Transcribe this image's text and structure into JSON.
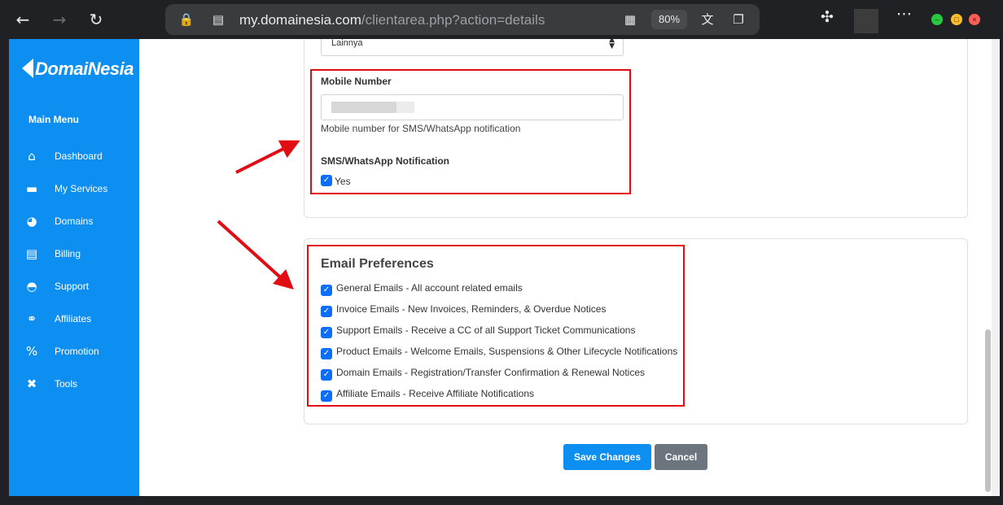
{
  "browser": {
    "url_host": "my.domainesia.com",
    "url_path": "/clientarea.php?action=details",
    "zoom": "80%"
  },
  "sidebar": {
    "logo": "DomaiNesia",
    "menu_title": "Main Menu",
    "items": [
      {
        "label": "Dashboard",
        "icon": "home-icon"
      },
      {
        "label": "My Services",
        "icon": "server-icon"
      },
      {
        "label": "Domains",
        "icon": "globe-icon"
      },
      {
        "label": "Billing",
        "icon": "receipt-icon"
      },
      {
        "label": "Support",
        "icon": "headset-icon"
      },
      {
        "label": "Affiliates",
        "icon": "handshake-icon"
      },
      {
        "label": "Promotion",
        "icon": "percent-icon"
      },
      {
        "label": "Tools",
        "icon": "tools-icon"
      }
    ]
  },
  "contact": {
    "select_value": "Lainnya",
    "mobile_label": "Mobile Number",
    "mobile_help": "Mobile number for SMS/WhatsApp notification",
    "notif_label": "SMS/WhatsApp Notification",
    "notif_checkbox": "Yes"
  },
  "email_prefs": {
    "title": "Email Preferences",
    "options": [
      "General Emails - All account related emails",
      "Invoice Emails - New Invoices, Reminders, & Overdue Notices",
      "Support Emails - Receive a CC of all Support Ticket Communications",
      "Product Emails - Welcome Emails, Suspensions & Other Lifecycle Notifications",
      "Domain Emails - Registration/Transfer Confirmation & Renewal Notices",
      "Affiliate Emails - Receive Affiliate Notifications"
    ]
  },
  "actions": {
    "save": "Save Changes",
    "cancel": "Cancel"
  },
  "colors": {
    "brand": "#0d8ff2",
    "annotation_red": "#e20c13",
    "checkbox": "#0d6efd"
  }
}
